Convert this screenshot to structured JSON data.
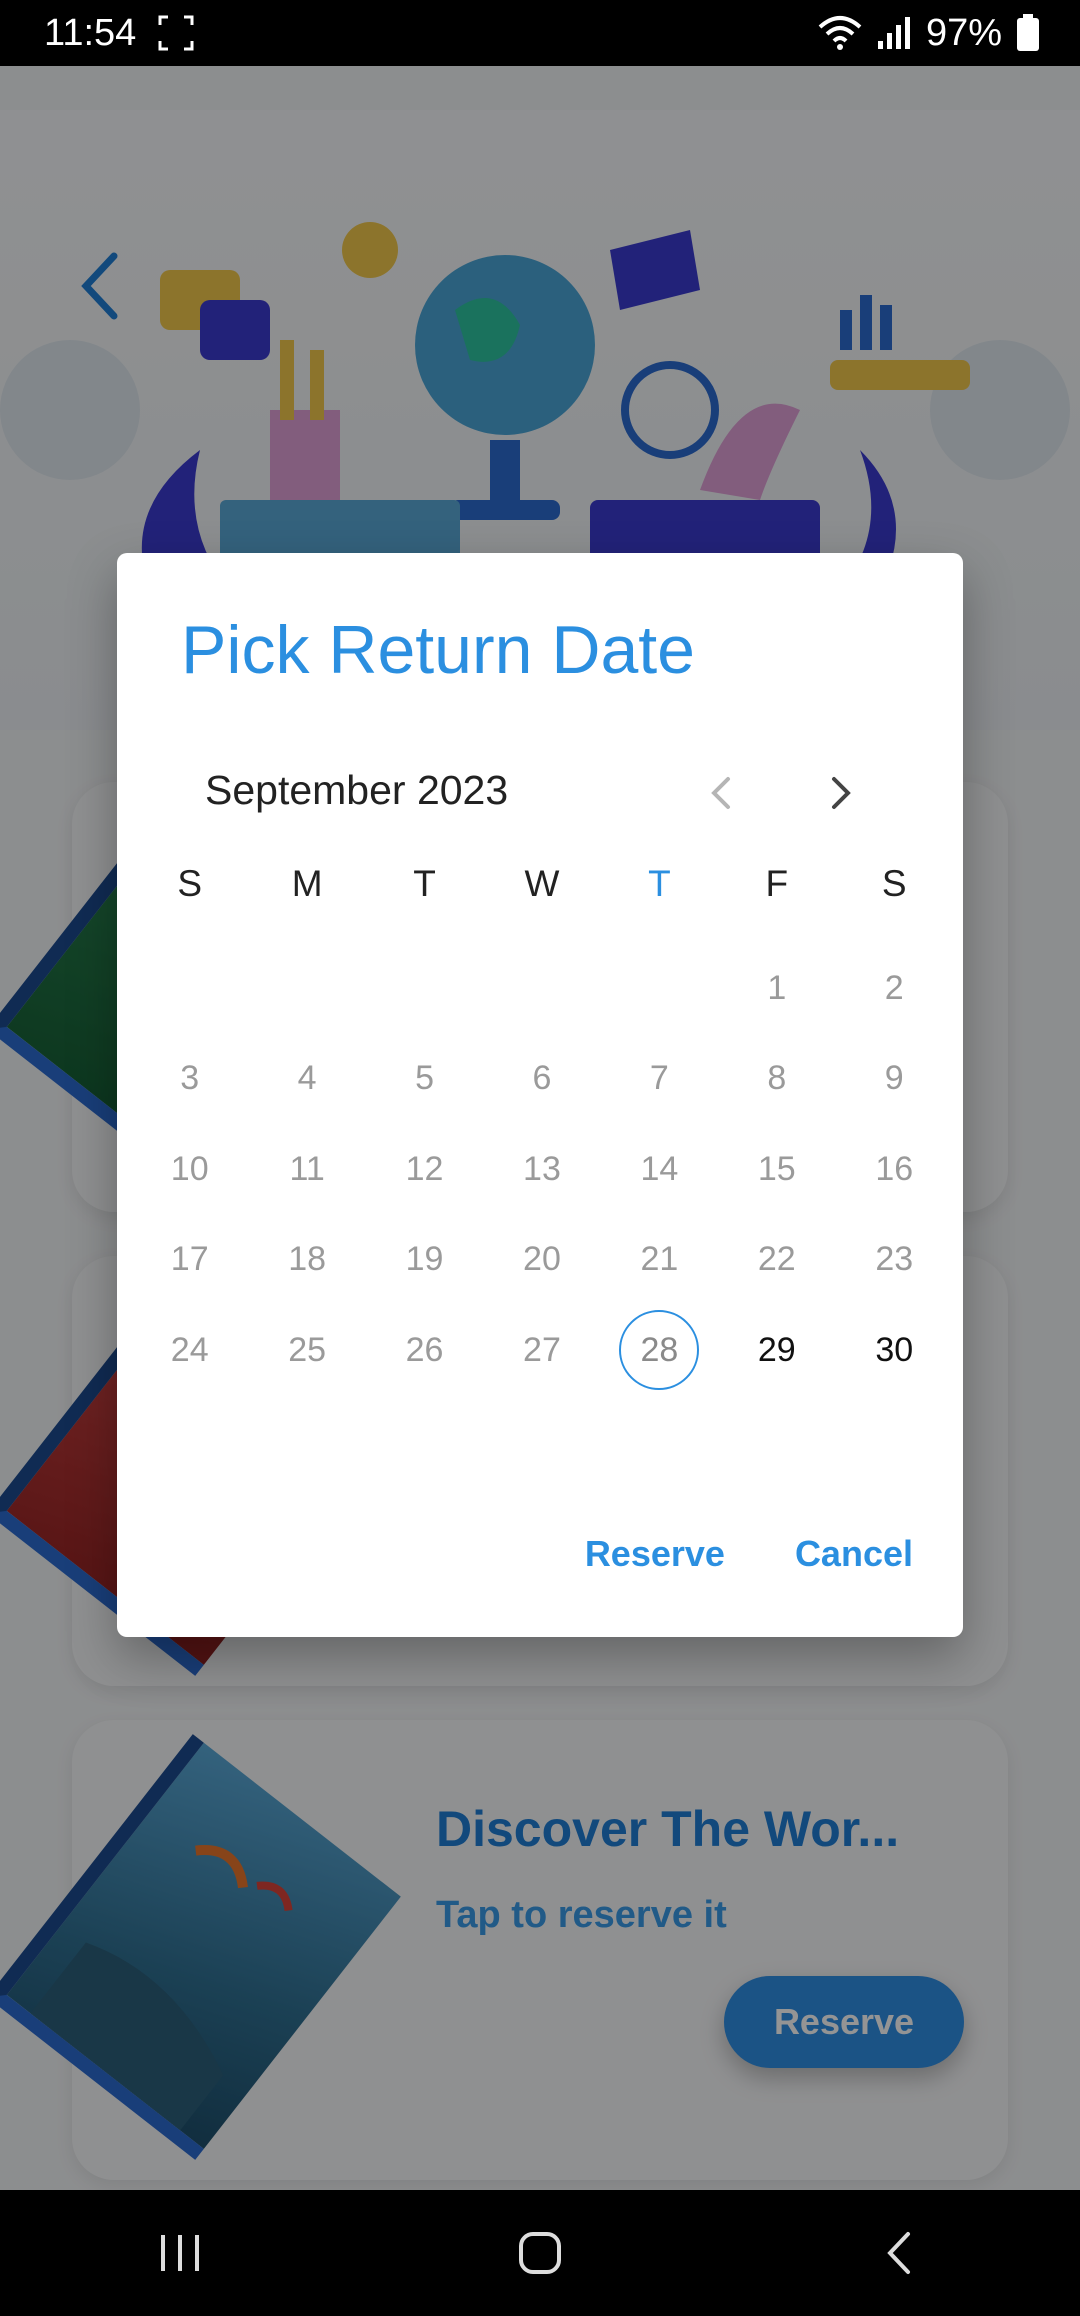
{
  "status_bar": {
    "time": "11:54",
    "battery": "97%"
  },
  "background": {
    "card_title": "Discover The Wor...",
    "card_subtitle": "Tap to reserve it",
    "card_button": "Reserve"
  },
  "dialog": {
    "title": "Pick Return Date",
    "month": "September 2023",
    "weekdays": [
      "S",
      "M",
      "T",
      "W",
      "T",
      "F",
      "S"
    ],
    "today_weekday_index": 4,
    "weeks": [
      [
        "",
        "",
        "",
        "",
        "",
        "1",
        "2"
      ],
      [
        "3",
        "4",
        "5",
        "6",
        "7",
        "8",
        "9"
      ],
      [
        "10",
        "11",
        "12",
        "13",
        "14",
        "15",
        "16"
      ],
      [
        "17",
        "18",
        "19",
        "20",
        "21",
        "22",
        "23"
      ],
      [
        "24",
        "25",
        "26",
        "27",
        "28",
        "29",
        "30"
      ]
    ],
    "selected_day": "28",
    "enabled_days": [
      "29",
      "30"
    ],
    "reserve_label": "Reserve",
    "cancel_label": "Cancel"
  },
  "colors": {
    "accent": "#2b8fe0",
    "dialog_bg": "#ffffff",
    "scrim": "rgba(0,0,0,0.42)"
  }
}
